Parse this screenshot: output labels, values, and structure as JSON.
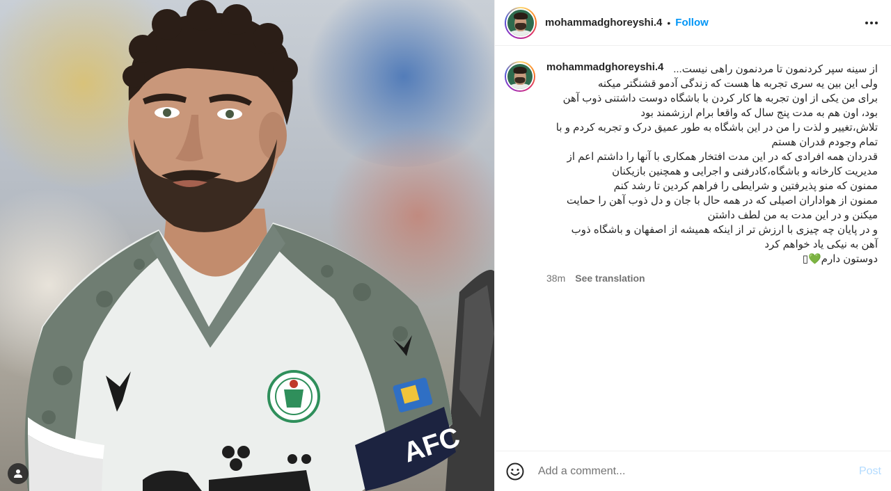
{
  "post": {
    "username": "mohammadghoreyshi.4",
    "follow_label": "Follow",
    "separator": "•",
    "caption_lines": [
      "از سینه سپر کردنمون تا مردنمون راهی نیست... ",
      "ولی این بین یه سری تجربه ها هست که زندگی آدمو قشنگتر میکنه",
      "برای من یکی از اون تجربه ها کار کردن با باشگاه دوست داشتنی ذوب آهن",
      "بود، اون هم به مدت پنج سال که واقعا برام ارزشمند بود",
      "تلاش،تغییر و لذت را من در این باشگاه به طور عمیق درک و تجربه کردم و با",
      "تمام وجودم قدران هستم",
      "قدردان همه افرادی که در این مدت افتخار همکاری با آنها را داشتم اعم از",
      "مدیریت کارخانه و باشگاه،کادرفنی و اجرایی و همچنین بازیکنان",
      "ممنون که منو پذیرفتین و شرایطی را فراهم کردین تا رشد کنم",
      "ممنون از هواداران اصیلی که در همه حال با جان و دل ذوب آهن را حمایت",
      "میکنن و در این مدت به من لطف داشتن",
      "و در پایان چه چیزی با ارزش تر از اینکه همیشه از اصفهان و باشگاه ذوب",
      "آهن به نیکی یاد خواهم کرد",
      "دوستون دارم💚▯"
    ],
    "timestamp": "38m",
    "see_translation": "See translation",
    "comment_placeholder": "Add a comment...",
    "post_label": "Post"
  },
  "media": {
    "shirt_text": "AFC"
  },
  "icons": {
    "more": "more-options-icon",
    "emoji": "emoji-icon",
    "user_tag": "user-tag-icon"
  },
  "colors": {
    "follow": "#0095f6",
    "post_disabled": "#b3dbff",
    "secondary_text": "#737373",
    "border": "#efefef"
  }
}
